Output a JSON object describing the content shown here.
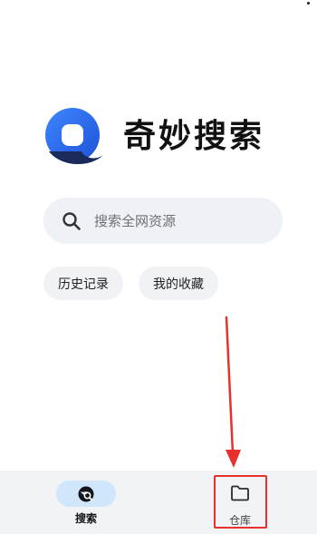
{
  "app": {
    "name": "奇妙搜索"
  },
  "search": {
    "placeholder": "搜索全网资源"
  },
  "quick_actions": {
    "history": "历史记录",
    "favorites": "我的收藏"
  },
  "tabbar": {
    "tabs": [
      {
        "label": "搜索",
        "icon": "search-globe-icon",
        "active": true
      },
      {
        "label": "仓库",
        "icon": "folder-icon",
        "active": false
      }
    ]
  },
  "colors": {
    "brand_blue": "#2f6ff1",
    "brand_navy": "#1b2a5c",
    "search_bg": "#eef1f5",
    "tab_active_bg": "#cfe6fb",
    "tabbar_bg": "#f1f3f6",
    "annotation_red": "#e8302c"
  }
}
